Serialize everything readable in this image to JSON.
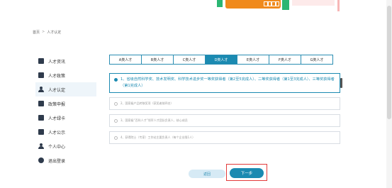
{
  "breadcrumb": {
    "home": "首页",
    "separator": ">",
    "current": "人才认定"
  },
  "sidebar": {
    "items": [
      {
        "label": "人才资讯",
        "icon": "document-icon"
      },
      {
        "label": "人才政策",
        "icon": "document-icon"
      },
      {
        "label": "人才认定",
        "icon": "user-icon",
        "active": true
      },
      {
        "label": "政策申报",
        "icon": "document-icon"
      },
      {
        "label": "人才绿卡",
        "icon": "card-icon"
      },
      {
        "label": "人才公示",
        "icon": "announcement-icon"
      },
      {
        "label": "个人中心",
        "icon": "people-icon"
      },
      {
        "label": "退出登录",
        "icon": "logout-icon"
      }
    ]
  },
  "tabs": [
    {
      "label": "A类人才"
    },
    {
      "label": "B类人才"
    },
    {
      "label": "C类人才"
    },
    {
      "label": "D类人才",
      "active": true
    },
    {
      "label": "E类人才"
    },
    {
      "label": "F类人才"
    },
    {
      "label": "G类人才"
    }
  ],
  "options": [
    {
      "text": "1、省级自然科学奖、技术发明奖、科学技术进步奖一等奖获得者（第2至5完成人）、二等奖获得者（第1至3完成人）、三等奖获得者（第1完成人）",
      "selected": true
    },
    {
      "text": "2、国家级产品转移奖项（获奖者前四名）",
      "selected": false
    },
    {
      "text": "3、国家级“百科人才”领军人才团队负责人、核心成员",
      "selected": false
    },
    {
      "text": "4、获得院士（专家）工作站主要负责人（每个企业限1人）",
      "selected": false
    }
  ],
  "buttons": {
    "back": "返回",
    "next": "下一步"
  },
  "colors": {
    "accent": "#1b8ab1",
    "highlight": "#e23b3b"
  }
}
